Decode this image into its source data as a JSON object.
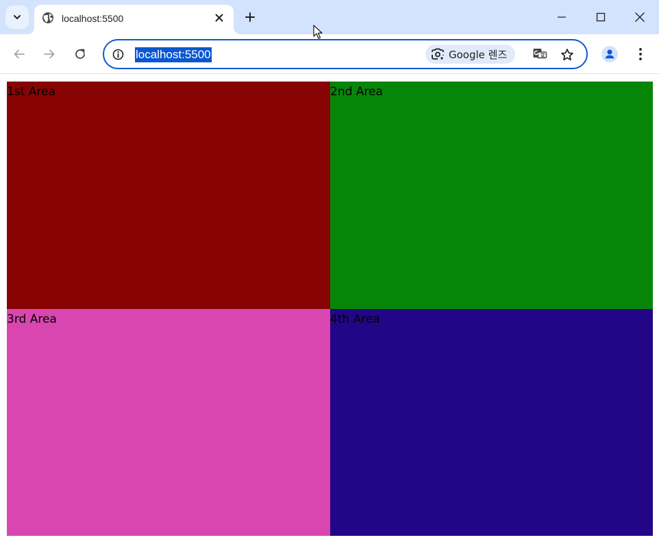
{
  "browser": {
    "tab": {
      "title": "localhost:5500"
    },
    "address_bar": {
      "url": "localhost:5500"
    },
    "lens_chip": {
      "label": "Google 렌즈"
    }
  },
  "colors": {
    "area_1": "#880404",
    "area_2": "#078508",
    "area_3": "#d946b0",
    "area_4": "#230687",
    "selection": "#0b57d0",
    "tabstrip": "#d3e3fd"
  },
  "page": {
    "areas": [
      {
        "label": "1st Area"
      },
      {
        "label": "2nd Area"
      },
      {
        "label": "3rd Area"
      },
      {
        "label": "4th Area"
      }
    ]
  },
  "icons": {
    "tab_search": "chevron-down-icon",
    "favicon": "globe-icon",
    "tab_close": "close-icon",
    "new_tab": "plus-icon",
    "minimize": "minimize-icon",
    "maximize": "maximize-icon",
    "close": "close-icon",
    "back": "arrow-left-icon",
    "forward": "arrow-right-icon",
    "reload": "reload-icon",
    "site_info": "info-icon",
    "lens": "camera-lens-icon",
    "translate": "translate-icon",
    "bookmark": "star-icon",
    "profile": "person-icon",
    "menu": "kebab-menu-icon"
  }
}
